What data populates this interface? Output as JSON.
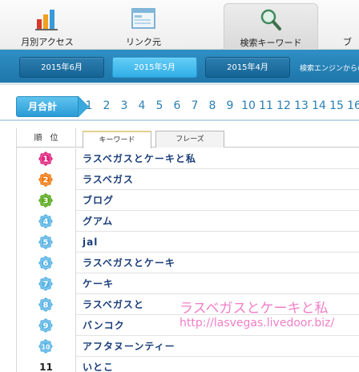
{
  "top_tabs": [
    {
      "label": "月別アクセス",
      "icon": "bar-chart-icon"
    },
    {
      "label": "リンク元",
      "icon": "browser-window-icon"
    },
    {
      "label": "検索キーワード",
      "icon": "magnifier-icon"
    },
    {
      "label": "ブ",
      "icon": "truncated-icon"
    }
  ],
  "months": [
    "2015年6月",
    "2015年5月",
    "2015年4月"
  ],
  "month_note": "検索エンジンからの",
  "day_total_label": "月合計",
  "days": [
    "1",
    "2",
    "3",
    "4",
    "5",
    "6",
    "7",
    "8",
    "9",
    "10",
    "11",
    "12",
    "13",
    "14",
    "15",
    "16"
  ],
  "list": {
    "rank_header": "順　位",
    "tabs": [
      "キーワード",
      "フレーズ"
    ],
    "rows": [
      {
        "rank": "1",
        "keyword": "ラスベガスとケーキと私",
        "badge_color": "#e0267f"
      },
      {
        "rank": "2",
        "keyword": "ラスベガス",
        "badge_color": "#f07a12"
      },
      {
        "rank": "3",
        "keyword": "ブログ",
        "badge_color": "#5aa91d"
      },
      {
        "rank": "4",
        "keyword": "グアム",
        "badge_color": "#5bb5e6"
      },
      {
        "rank": "5",
        "keyword": "jal",
        "badge_color": "#5bb5e6"
      },
      {
        "rank": "6",
        "keyword": "ラスベガスとケーキ",
        "badge_color": "#5bb5e6"
      },
      {
        "rank": "7",
        "keyword": "ケーキ",
        "badge_color": "#5bb5e6"
      },
      {
        "rank": "8",
        "keyword": "ラスベガスと",
        "badge_color": "#5bb5e6"
      },
      {
        "rank": "9",
        "keyword": "バンコク",
        "badge_color": "#5bb5e6"
      },
      {
        "rank": "10",
        "keyword": "アフタヌーンティー",
        "badge_color": "#5bb5e6"
      },
      {
        "rank": "11",
        "keyword": "いとこ",
        "badge_color": ""
      }
    ]
  },
  "watermark": {
    "title": "ラスベガスとケーキと私",
    "url": "http://lasvegas.livedoor.biz/"
  },
  "colors": {
    "accent_blue": "#2a8ac0",
    "keyword_text": "#1b3e7a",
    "watermark_pink": "#f07fc7"
  }
}
